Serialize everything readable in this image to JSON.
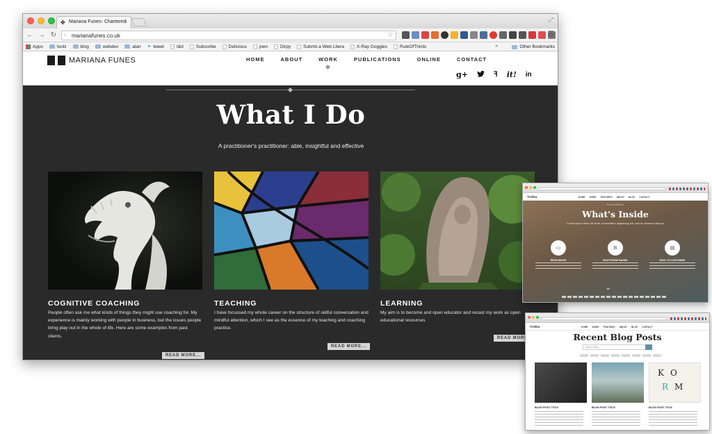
{
  "browser": {
    "tab_title": "Mariana Funes- Chartered",
    "url": "marianafunes.co.uk",
    "bookmarks": [
      {
        "label": "Apps",
        "kind": "apps"
      },
      {
        "label": "toolz",
        "kind": "folder"
      },
      {
        "label": "blog",
        "kind": "folder"
      },
      {
        "label": "webdev",
        "kind": "folder"
      },
      {
        "label": "alan",
        "kind": "folder"
      },
      {
        "label": "tweet",
        "kind": "twitter"
      },
      {
        "label": "t&d",
        "kind": "page"
      },
      {
        "label": "Subscribe",
        "kind": "page"
      },
      {
        "label": "Delicious",
        "kind": "page"
      },
      {
        "label": "pwn",
        "kind": "page"
      },
      {
        "label": "Dirpy",
        "kind": "page"
      },
      {
        "label": "Submit a Web Litera",
        "kind": "page"
      },
      {
        "label": "X-Ray Goggles",
        "kind": "page"
      },
      {
        "label": "RuleOfThirds",
        "kind": "page"
      }
    ],
    "overflow_label": "»",
    "other_bookmarks": "Other Bookmarks"
  },
  "site": {
    "logo_text": "MARIANA FUNES",
    "nav": [
      "HOME",
      "ABOUT",
      "WORK",
      "PUBLICATIONS",
      "ONLINE",
      "CONTACT"
    ],
    "active_nav": "WORK",
    "social": [
      "g+",
      "twitter",
      "delicious",
      "it!",
      "in"
    ],
    "hero_title": "What I Do",
    "hero_subtitle": "A practitioner's practitioner: able, insightful and effective",
    "cards": [
      {
        "title": "COGNITIVE COACHING",
        "text": "People often ask me what kinds of things they might use coaching for. My experience is mainly working with people in business, but the issues people bring play out in the whole of life. Here are some examples from past clients.",
        "button": "READ MORE..."
      },
      {
        "title": "TEACHING",
        "text": "I have focussed my whole career on the structure of skilful conversation and mindful attention, which I see as the essence of my teaching and coaching practice.",
        "button": "READ MORE..."
      },
      {
        "title": "LEARNING",
        "text": "My aim is to become and open educator and recast my work as open educational resources",
        "button": "READ MORE..."
      }
    ]
  },
  "mini_inside": {
    "logo": "Trekka",
    "kicker": "FEATURES",
    "title": "What's Inside",
    "subtitle": "Lorem ipsum dolor sit amet, consectetur adipiscing elit, sed do eiusmod tempor",
    "features": [
      "RESPONSIVE",
      "BOOTSTRAP BASED",
      "EASY TO CUSTOMIZE"
    ]
  },
  "mini_blog": {
    "logo": "Trekka",
    "title": "Recent Blog Posts",
    "search_placeholder": "Search Blog",
    "posts": [
      "BLOG POST TITLE",
      "BLOG POST TITLE",
      "BLOG POST TITLE"
    ]
  }
}
